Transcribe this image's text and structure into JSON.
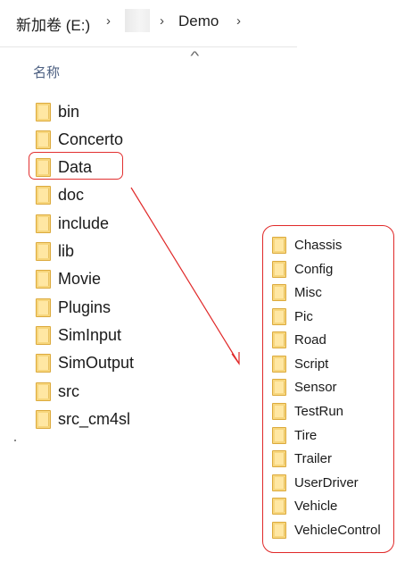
{
  "breadcrumb": {
    "drive": "新加卷 (E:)",
    "current": "Demo"
  },
  "list_header": {
    "name_col": "名称"
  },
  "folders": [
    {
      "label": "bin"
    },
    {
      "label": "Concerto"
    },
    {
      "label": "Data"
    },
    {
      "label": "doc"
    },
    {
      "label": "include"
    },
    {
      "label": "lib"
    },
    {
      "label": "Movie"
    },
    {
      "label": "Plugins"
    },
    {
      "label": "SimInput"
    },
    {
      "label": "SimOutput"
    },
    {
      "label": "src"
    },
    {
      "label": "src_cm4sl"
    }
  ],
  "subfolders": [
    {
      "label": "Chassis"
    },
    {
      "label": "Config"
    },
    {
      "label": "Misc"
    },
    {
      "label": "Pic"
    },
    {
      "label": "Road"
    },
    {
      "label": "Script"
    },
    {
      "label": "Sensor"
    },
    {
      "label": "TestRun"
    },
    {
      "label": "Tire"
    },
    {
      "label": "Trailer"
    },
    {
      "label": "UserDriver"
    },
    {
      "label": "Vehicle"
    },
    {
      "label": "VehicleControl"
    }
  ],
  "colors": {
    "annotation": "#e02828",
    "folder_fill": "#f7d67d",
    "folder_border": "#dcaa3d"
  },
  "icons": {
    "chevron": "chevron-right-icon",
    "sort": "sort-up-icon",
    "folder": "folder-icon"
  }
}
